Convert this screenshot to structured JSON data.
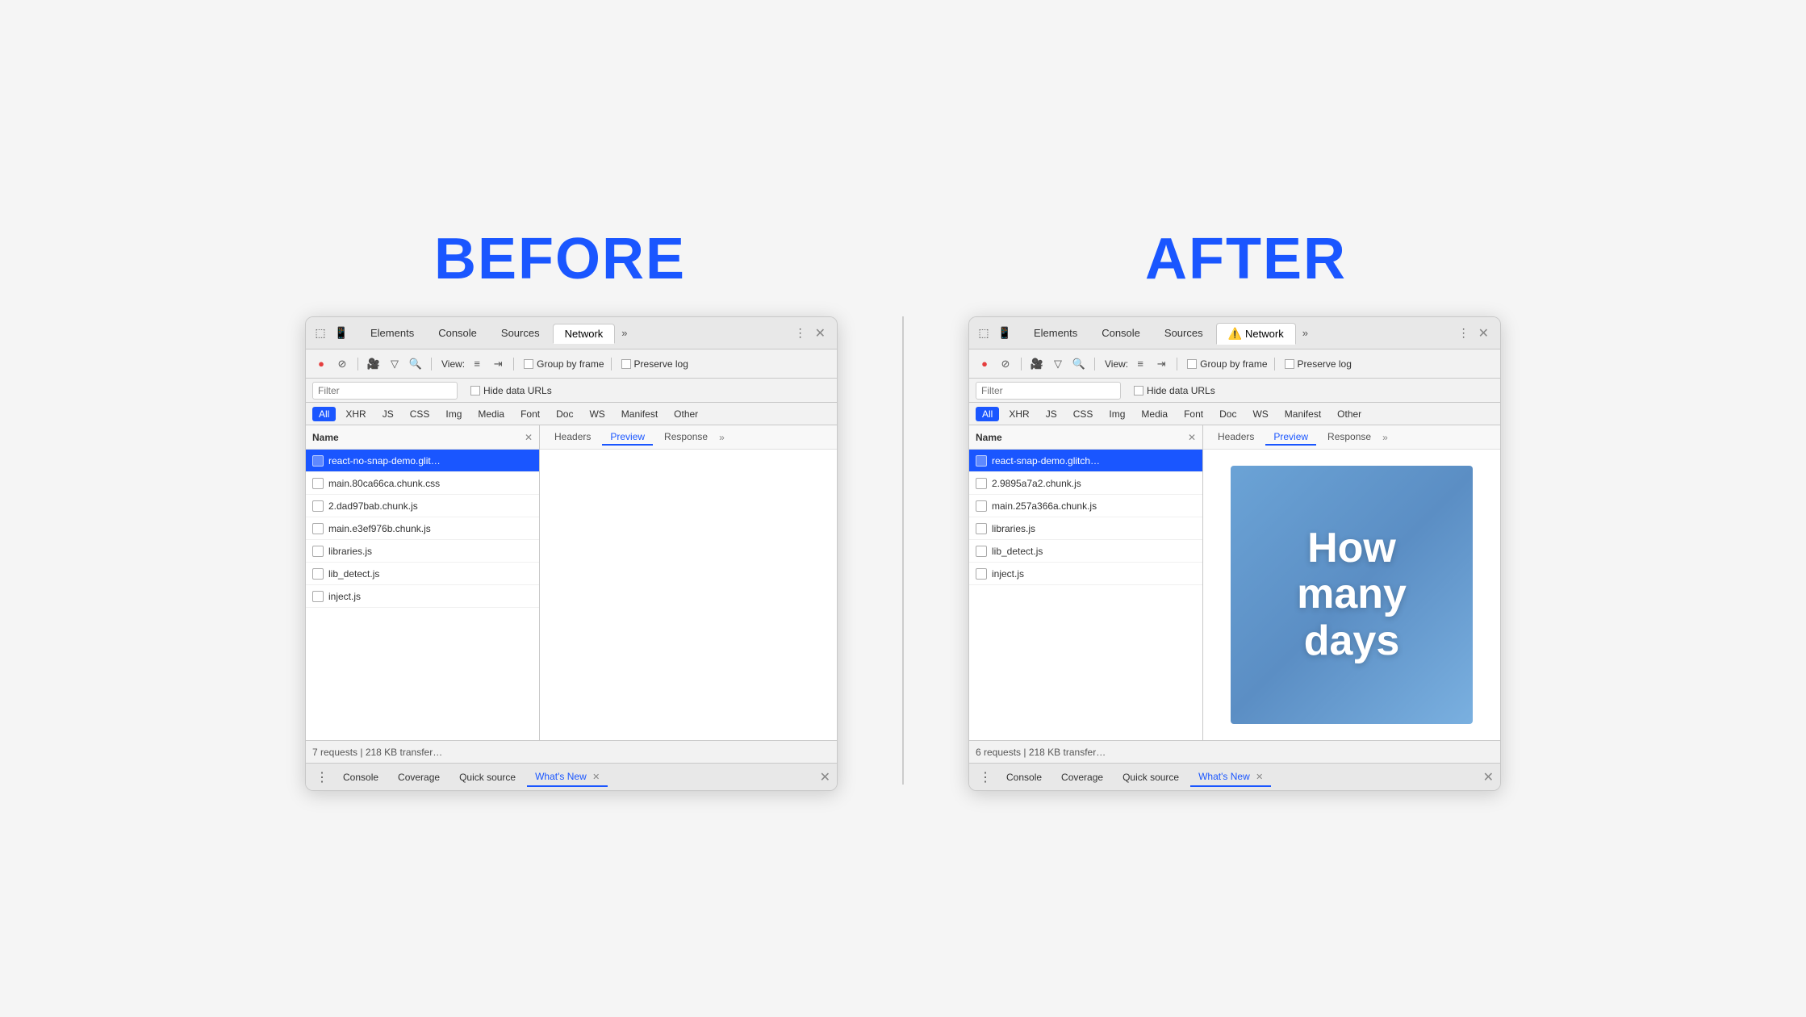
{
  "labels": {
    "before": "BEFORE",
    "after": "AFTER"
  },
  "before": {
    "tabs": {
      "items": [
        "Elements",
        "Console",
        "Sources",
        "Network"
      ],
      "active": "Network",
      "overflow": "»",
      "close": "✕"
    },
    "toolbar": {
      "record_icon": "●",
      "stop_icon": "⊘",
      "camera_icon": "📷",
      "filter_icon": "▼",
      "search_icon": "🔍",
      "view_label": "View:",
      "grid_icon": "≡",
      "indent_icon": "⇥",
      "group_by_frame_label": "Group by frame",
      "preserve_log_label": "Preserve log"
    },
    "filter": {
      "placeholder": "Filter",
      "hide_data_urls": "Hide data URLs"
    },
    "type_filters": [
      "All",
      "XHR",
      "JS",
      "CSS",
      "Img",
      "Media",
      "Font",
      "Doc",
      "WS",
      "Manifest",
      "Other"
    ],
    "active_type": "All",
    "file_list": {
      "header": "Name",
      "files": [
        {
          "name": "react-no-snap-demo.glit…",
          "selected": true
        },
        {
          "name": "main.80ca66ca.chunk.css",
          "selected": false
        },
        {
          "name": "2.dad97bab.chunk.js",
          "selected": false
        },
        {
          "name": "main.e3ef976b.chunk.js",
          "selected": false
        },
        {
          "name": "libraries.js",
          "selected": false
        },
        {
          "name": "lib_detect.js",
          "selected": false
        },
        {
          "name": "inject.js",
          "selected": false
        }
      ]
    },
    "preview_tabs": [
      "Headers",
      "Preview",
      "Response"
    ],
    "active_preview_tab": "Preview",
    "preview_overflow": "»",
    "preview_content": "empty",
    "status": "7 requests | 218 KB transfer…",
    "bottom_tabs": [
      "Console",
      "Coverage",
      "Quick source",
      "What's New"
    ],
    "active_bottom_tab": "What's New"
  },
  "after": {
    "tabs": {
      "items": [
        "Elements",
        "Console",
        "Sources",
        "Network"
      ],
      "active": "Network",
      "has_warning": true,
      "overflow": "»",
      "close": "✕"
    },
    "toolbar": {
      "record_icon": "●",
      "stop_icon": "⊘",
      "camera_icon": "📷",
      "filter_icon": "▼",
      "search_icon": "🔍",
      "view_label": "View:",
      "grid_icon": "≡",
      "indent_icon": "⇥",
      "group_by_frame_label": "Group by frame",
      "preserve_log_label": "Preserve log"
    },
    "filter": {
      "placeholder": "Filter",
      "hide_data_urls": "Hide data URLs"
    },
    "type_filters": [
      "All",
      "XHR",
      "JS",
      "CSS",
      "Img",
      "Media",
      "Font",
      "Doc",
      "WS",
      "Manifest",
      "Other"
    ],
    "active_type": "All",
    "file_list": {
      "header": "Name",
      "files": [
        {
          "name": "react-snap-demo.glitch…",
          "selected": true
        },
        {
          "name": "2.9895a7a2.chunk.js",
          "selected": false
        },
        {
          "name": "main.257a366a.chunk.js",
          "selected": false
        },
        {
          "name": "libraries.js",
          "selected": false
        },
        {
          "name": "lib_detect.js",
          "selected": false
        },
        {
          "name": "inject.js",
          "selected": false
        }
      ]
    },
    "preview_tabs": [
      "Headers",
      "Preview",
      "Response"
    ],
    "active_preview_tab": "Preview",
    "preview_overflow": "»",
    "preview_content": "image",
    "image_text": "How\nmany\ndays",
    "status": "6 requests | 218 KB transfer…",
    "bottom_tabs": [
      "Console",
      "Coverage",
      "Quick source",
      "What's New"
    ],
    "active_bottom_tab": "What's New"
  }
}
